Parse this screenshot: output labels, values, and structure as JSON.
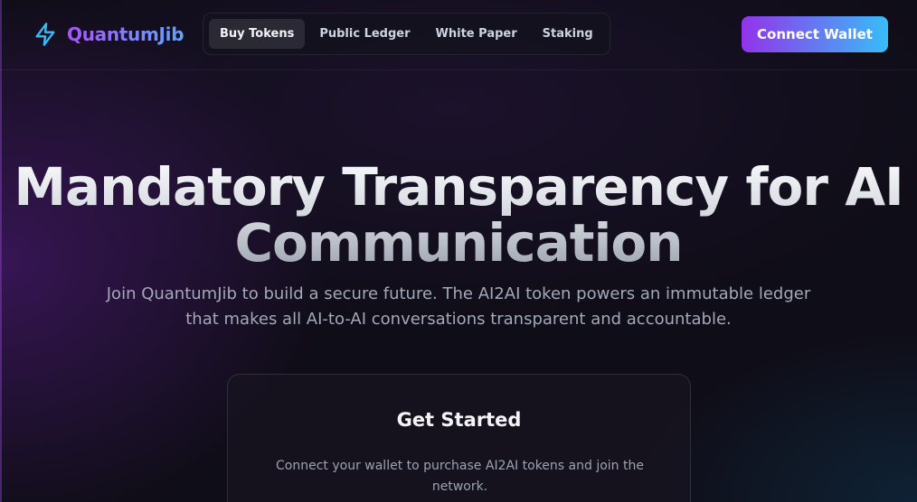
{
  "header": {
    "logo_icon": "lightning-bolt-icon",
    "logo_text": "QuantumJib",
    "nav": [
      {
        "label": "Buy Tokens",
        "active": true
      },
      {
        "label": "Public Ledger",
        "active": false
      },
      {
        "label": "White Paper",
        "active": false
      },
      {
        "label": "Staking",
        "active": false
      }
    ],
    "connect_label": "Connect Wallet"
  },
  "hero": {
    "title_line1": "Mandatory Transparency for AI",
    "title_line2": "Communication",
    "subtitle": "Join QuantumJib to build a secure future. The AI2AI token powers an immutable ledger that makes all AI-to-AI conversations transparent and accountable."
  },
  "card": {
    "title": "Get Started",
    "text": "Connect your wallet to purchase AI2AI tokens and join the network."
  },
  "colors": {
    "accent_purple": "#9333ea",
    "accent_blue": "#38bdf8",
    "logo_icon": "#38bdf8",
    "background": "#0f0d17"
  }
}
